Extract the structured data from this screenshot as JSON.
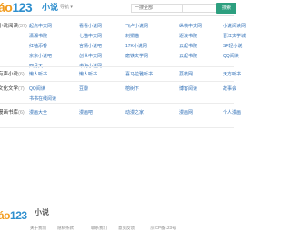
{
  "header": {
    "logo_a": "áo",
    "logo_num": "123",
    "logo_suffix": "小说",
    "nav_toggle": "导航 ▾",
    "search_hint": "一搜全部",
    "search_button": "搜索"
  },
  "sections": [
    {
      "label": "小说阅读",
      "count": "(37)",
      "rows": [
        [
          "起点中文网",
          "看看小说网",
          "飞卢小说网",
          "纵横中文网",
          "小说阅读网"
        ],
        [
          "潇湘书院",
          "七猫中文网",
          "刺猬猫",
          "逐浪书院",
          "晋江文学城"
        ],
        [
          "红袖添香",
          "言情小说吧",
          "17K小说网",
          "云起书院",
          "SF轻小说"
        ],
        [
          "京东小说吧",
          "创世中文网",
          "磨铁文学网",
          "云起书院",
          "QQ阅读"
        ],
        [
          "四月天",
          "书海小说网"
        ]
      ]
    },
    {
      "label": "有声小说",
      "count": "(6)",
      "rows": [
        [
          "懒人听书",
          "懒人听书",
          "喜马拉雅听书",
          "荔枝网",
          "天方听书"
        ]
      ]
    },
    {
      "label": "文化文学",
      "count": "(7)",
      "rows": [
        [
          "QQ阅读",
          "豆瓣",
          "榕树下",
          "博客阅读",
          "故事会"
        ],
        [
          "书书在线阅读"
        ]
      ]
    },
    {
      "label": "漫画书库",
      "count": "(6)",
      "rows": [
        [
          "漫画大全",
          "漫画吧",
          "动漫之家",
          "漫画网",
          "个人漫画"
        ]
      ]
    }
  ],
  "footer": {
    "logo_a": "áo",
    "logo_num": "123",
    "logo_suffix": "小说",
    "links": [
      "关于我们",
      "隐私条款",
      "联系我们",
      "意见反馈",
      "京ICP备123号"
    ]
  },
  "colors": {
    "brand_orange": "#f29c1f",
    "brand_blue": "#2f8fce",
    "link_blue": "#2f6fb7",
    "search_green": "#2d9f7f"
  }
}
